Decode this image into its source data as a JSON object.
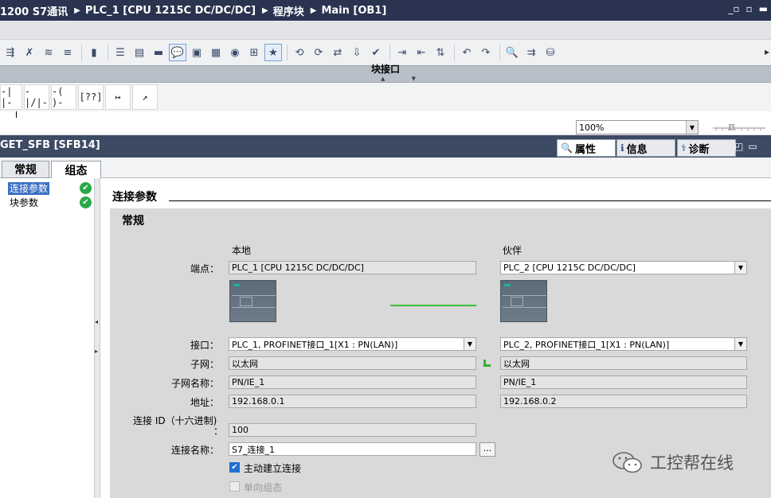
{
  "breadcrumb": [
    "1200 S7通讯",
    "PLC_1 [CPU 1215C DC/DC/DC]",
    "程序块",
    "Main [OB1]"
  ],
  "window_controls": [
    "restore-icon",
    "maximize-icon",
    "close-icon"
  ],
  "interface_bar": {
    "title": "块接口"
  },
  "lad_elements": [
    "-| |-",
    "-|/|-",
    "-( )-",
    "[??]",
    "↦",
    "↗"
  ],
  "zoom": {
    "value": "100%"
  },
  "inspector": {
    "title": "GET_SFB [SFB14]",
    "tabs": [
      {
        "label": "属性",
        "icon": "properties-icon",
        "active": true
      },
      {
        "label": "信息",
        "icon": "info-icon",
        "active": false
      },
      {
        "label": "诊断",
        "icon": "diagnostics-icon",
        "active": false
      }
    ]
  },
  "page_tabs": [
    {
      "label": "常规",
      "active": false
    },
    {
      "label": "组态",
      "active": true
    }
  ],
  "tree": [
    {
      "label": "连接参数",
      "selected": true,
      "status": "ok"
    },
    {
      "label": "块参数",
      "selected": false,
      "status": "ok"
    }
  ],
  "section": {
    "title": "连接参数",
    "subtitle": "常规",
    "local_header": "本地",
    "partner_header": "伙伴",
    "rows": {
      "endpoint": {
        "label": "端点：",
        "local": "PLC_1 [CPU 1215C DC/DC/DC]",
        "partner": "PLC_2 [CPU 1215C DC/DC/DC]"
      },
      "interface": {
        "label": "接口：",
        "local": "PLC_1, PROFINET接口_1[X1 : PN(LAN)]",
        "partner": "PLC_2, PROFINET接口_1[X1 : PN(LAN)]"
      },
      "subnet": {
        "label": "子网：",
        "local": "以太网",
        "partner": "以太网"
      },
      "subnet_name": {
        "label": "子网名称：",
        "local": "PN/IE_1",
        "partner": "PN/IE_1"
      },
      "address": {
        "label": "地址：",
        "local": "192.168.0.1",
        "partner": "192.168.0.2"
      }
    },
    "connection_id": {
      "label_line1": "连接 ID（十六进制)",
      "label_line2": "：",
      "value": "100"
    },
    "connection_name": {
      "label": "连接名称：",
      "value": "S7_连接_1",
      "browse": "..."
    },
    "active_connect": {
      "label": "主动建立连接",
      "checked": true
    },
    "one_way": {
      "label": "单向组态",
      "checked": false,
      "disabled": true
    }
  },
  "watermark": "工控帮在线",
  "colors": {
    "title_bg": "#2a3450",
    "accent": "#3a6fc4",
    "ok_green": "#2aa84a",
    "link_green": "#3cbf3c"
  }
}
